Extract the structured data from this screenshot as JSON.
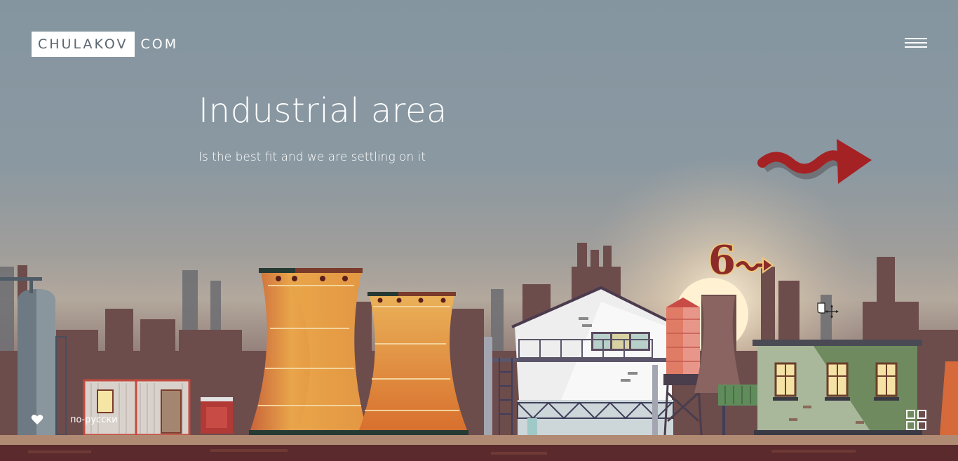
{
  "logo": {
    "primary": "CHULAKOV",
    "secondary": "COM"
  },
  "hero": {
    "title": "Industrial area",
    "subtitle": "Is the best fit and we are settling on it"
  },
  "sign": {
    "text": "6"
  },
  "footer": {
    "language_link": "по-русски"
  },
  "icons": {
    "menu": "hamburger-icon",
    "next": "red-wavy-arrow-icon",
    "like": "heart-icon",
    "grid": "grid-icon",
    "cursor": "hand-move-cursor-icon"
  },
  "colors": {
    "sky": "#8595a0",
    "accent_red": "#a52224",
    "tower_orange": "#e3a04a",
    "house_green": "#8aa07f"
  }
}
